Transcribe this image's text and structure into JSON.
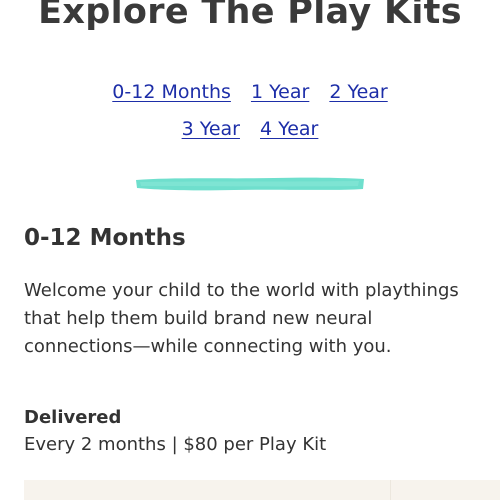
{
  "header": {
    "title": "Explore The Play Kits"
  },
  "age_nav": {
    "links": [
      {
        "label": "0-12 Months"
      },
      {
        "label": "1 Year"
      },
      {
        "label": "2 Year"
      },
      {
        "label": "3 Year"
      },
      {
        "label": "4 Year"
      }
    ]
  },
  "colors": {
    "link": "#1d2ea8",
    "divider_accent": "#5fdcc8",
    "card_background": "#f7f3ed"
  },
  "section": {
    "title": "0-12 Months",
    "description": "Welcome your child to the world with playthings that help them build brand new neural connections—while connecting with you.",
    "delivered_label": "Delivered",
    "delivered_value": "Every 2 months | $80 per Play Kit"
  }
}
